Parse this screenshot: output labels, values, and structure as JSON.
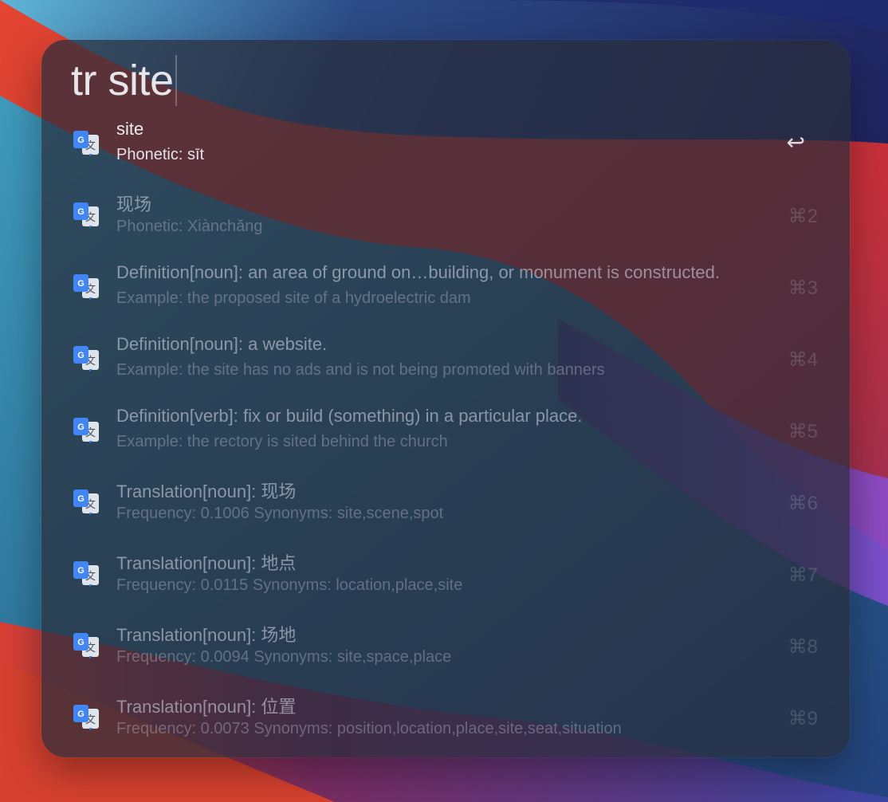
{
  "query": {
    "text": "tr site"
  },
  "results": [
    {
      "title": "site",
      "subtitle": "Phonetic: sīt",
      "shortcut": "↩",
      "selected": true
    },
    {
      "title": "现场",
      "subtitle": "Phonetic: Xiànchǎng",
      "shortcut": "⌘2"
    },
    {
      "title": "Definition[noun]: an area of ground on…building, or monument is constructed.",
      "subtitle": "Example: the proposed site of a hydroelectric dam",
      "shortcut": "⌘3"
    },
    {
      "title": "Definition[noun]: a website.",
      "subtitle": "Example: the site has no ads and is not being promoted with banners",
      "shortcut": "⌘4"
    },
    {
      "title": "Definition[verb]: fix or build (something) in a particular place.",
      "subtitle": "Example: the rectory is sited behind the church",
      "shortcut": "⌘5"
    },
    {
      "title": "Translation[noun]: 现场",
      "subtitle": "Frequency: 0.1006 Synonyms: site,scene,spot",
      "shortcut": "⌘6"
    },
    {
      "title": "Translation[noun]: 地点",
      "subtitle": "Frequency: 0.0115 Synonyms: location,place,site",
      "shortcut": "⌘7"
    },
    {
      "title": "Translation[noun]: 场地",
      "subtitle": "Frequency: 0.0094 Synonyms: site,space,place",
      "shortcut": "⌘8"
    },
    {
      "title": "Translation[noun]: 位置",
      "subtitle": "Frequency: 0.0073 Synonyms: position,location,place,site,seat,situation",
      "shortcut": "⌘9"
    }
  ],
  "icon": {
    "name": "google-translate-icon",
    "colors": {
      "blue": "#4285f4",
      "gray": "#dfe3ea"
    }
  }
}
